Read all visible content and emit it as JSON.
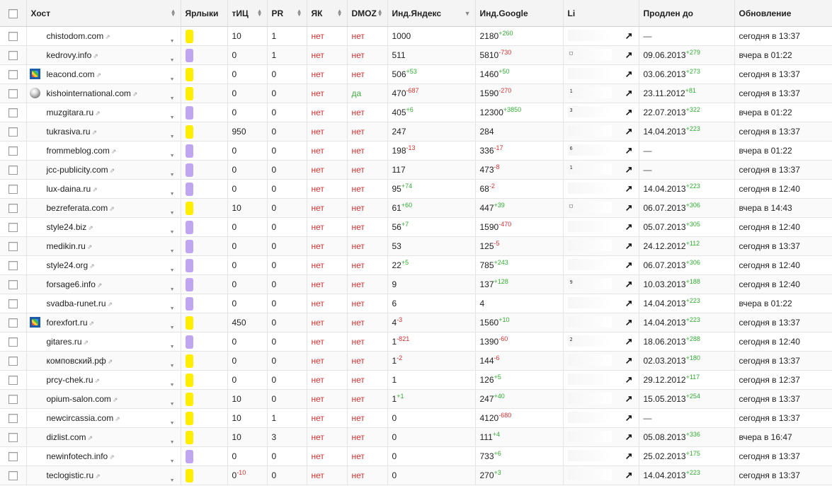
{
  "header": {
    "host": "Хост",
    "labels": "Ярлыки",
    "tic": "тИЦ",
    "pr": "PR",
    "yak": "ЯК",
    "dmoz": "DMOZ",
    "ind_yandex": "Инд.Яндекс",
    "ind_google": "Инд.Google",
    "li": "Li",
    "prolong": "Продлен до",
    "update": "Обновление"
  },
  "colors": {
    "yellow_label": "#ffee00",
    "purple_label": "#c0a6f0",
    "negative": "#cc3333",
    "positive": "#33aa33"
  },
  "rows": [
    {
      "host": "chistodom.com",
      "fav": "",
      "label": "yellow",
      "tic": "10",
      "tic_d": "",
      "pr": "1",
      "yak": "нет",
      "dmoz": "нет",
      "yandex": "1000",
      "yandex_d": "",
      "google": "2180",
      "google_d": "+260",
      "li": "",
      "prolong": "—",
      "prolong_d": "",
      "update": "сегодня в 13:37"
    },
    {
      "host": "kedrovy.info",
      "fav": "",
      "label": "purple",
      "tic": "0",
      "tic_d": "",
      "pr": "1",
      "yak": "нет",
      "dmoz": "нет",
      "yandex": "511",
      "yandex_d": "",
      "google": "5810",
      "google_d": "-730",
      "li": "□",
      "prolong": "09.06.2013",
      "prolong_d": "+279",
      "update": "вчера в 01:22"
    },
    {
      "host": "leacond.com",
      "fav": "joomla-icon",
      "label": "yellow",
      "tic": "0",
      "tic_d": "",
      "pr": "0",
      "yak": "нет",
      "dmoz": "нет",
      "yandex": "506",
      "yandex_d": "+53",
      "google": "1460",
      "google_d": "+50",
      "li": "",
      "prolong": "03.06.2013",
      "prolong_d": "+273",
      "update": "сегодня в 13:37"
    },
    {
      "host": "kishointernational.com",
      "fav": "globe-icon",
      "label": "yellow",
      "tic": "0",
      "tic_d": "",
      "pr": "0",
      "yak": "нет",
      "dmoz": "да",
      "yandex": "470",
      "yandex_d": "-687",
      "google": "1590",
      "google_d": "-270",
      "li": "1",
      "prolong": "23.11.2012",
      "prolong_d": "+81",
      "update": "сегодня в 13:37"
    },
    {
      "host": "muzgitara.ru",
      "fav": "",
      "label": "purple",
      "tic": "0",
      "tic_d": "",
      "pr": "0",
      "yak": "нет",
      "dmoz": "нет",
      "yandex": "405",
      "yandex_d": "+6",
      "google": "12300",
      "google_d": "+3850",
      "li": "3",
      "prolong": "22.07.2013",
      "prolong_d": "+322",
      "update": "вчера в 01:22"
    },
    {
      "host": "tukrasiva.ru",
      "fav": "",
      "label": "yellow",
      "tic": "950",
      "tic_d": "",
      "pr": "0",
      "yak": "нет",
      "dmoz": "нет",
      "yandex": "247",
      "yandex_d": "",
      "google": "284",
      "google_d": "",
      "li": "",
      "prolong": "14.04.2013",
      "prolong_d": "+223",
      "update": "сегодня в 13:37"
    },
    {
      "host": "frommeblog.com",
      "fav": "",
      "label": "purple",
      "tic": "0",
      "tic_d": "",
      "pr": "0",
      "yak": "нет",
      "dmoz": "нет",
      "yandex": "198",
      "yandex_d": "-13",
      "google": "336",
      "google_d": "-17",
      "li": "6",
      "prolong": "—",
      "prolong_d": "",
      "update": "вчера в 01:22"
    },
    {
      "host": "jcc-publicity.com",
      "fav": "",
      "label": "purple",
      "tic": "0",
      "tic_d": "",
      "pr": "0",
      "yak": "нет",
      "dmoz": "нет",
      "yandex": "117",
      "yandex_d": "",
      "google": "473",
      "google_d": "-8",
      "li": "1",
      "prolong": "—",
      "prolong_d": "",
      "update": "сегодня в 13:37"
    },
    {
      "host": "lux-daina.ru",
      "fav": "",
      "label": "purple",
      "tic": "0",
      "tic_d": "",
      "pr": "0",
      "yak": "нет",
      "dmoz": "нет",
      "yandex": "95",
      "yandex_d": "+74",
      "google": "68",
      "google_d": "-2",
      "li": "",
      "prolong": "14.04.2013",
      "prolong_d": "+223",
      "update": "сегодня в 12:40"
    },
    {
      "host": "bezreferata.com",
      "fav": "",
      "label": "yellow",
      "tic": "10",
      "tic_d": "",
      "pr": "0",
      "yak": "нет",
      "dmoz": "нет",
      "yandex": "61",
      "yandex_d": "+60",
      "google": "447",
      "google_d": "+39",
      "li": "□",
      "prolong": "06.07.2013",
      "prolong_d": "+306",
      "update": "вчера в 14:43"
    },
    {
      "host": "style24.biz",
      "fav": "",
      "label": "purple",
      "tic": "0",
      "tic_d": "",
      "pr": "0",
      "yak": "нет",
      "dmoz": "нет",
      "yandex": "56",
      "yandex_d": "+7",
      "google": "1590",
      "google_d": "-470",
      "li": "",
      "prolong": "05.07.2013",
      "prolong_d": "+305",
      "update": "сегодня в 12:40"
    },
    {
      "host": "medikin.ru",
      "fav": "",
      "label": "purple",
      "tic": "0",
      "tic_d": "",
      "pr": "0",
      "yak": "нет",
      "dmoz": "нет",
      "yandex": "53",
      "yandex_d": "",
      "google": "125",
      "google_d": "-5",
      "li": "",
      "prolong": "24.12.2012",
      "prolong_d": "+112",
      "update": "сегодня в 13:37"
    },
    {
      "host": "style24.org",
      "fav": "",
      "label": "purple",
      "tic": "0",
      "tic_d": "",
      "pr": "0",
      "yak": "нет",
      "dmoz": "нет",
      "yandex": "22",
      "yandex_d": "+5",
      "google": "785",
      "google_d": "+243",
      "li": "",
      "prolong": "06.07.2013",
      "prolong_d": "+306",
      "update": "сегодня в 12:40"
    },
    {
      "host": "forsage6.info",
      "fav": "",
      "label": "purple",
      "tic": "0",
      "tic_d": "",
      "pr": "0",
      "yak": "нет",
      "dmoz": "нет",
      "yandex": "9",
      "yandex_d": "",
      "google": "137",
      "google_d": "+128",
      "li": "9",
      "prolong": "10.03.2013",
      "prolong_d": "+188",
      "update": "сегодня в 12:40"
    },
    {
      "host": "svadba-runet.ru",
      "fav": "",
      "label": "purple",
      "tic": "0",
      "tic_d": "",
      "pr": "0",
      "yak": "нет",
      "dmoz": "нет",
      "yandex": "6",
      "yandex_d": "",
      "google": "4",
      "google_d": "",
      "li": "",
      "prolong": "14.04.2013",
      "prolong_d": "+223",
      "update": "вчера в 01:22"
    },
    {
      "host": "forexfort.ru",
      "fav": "joomla-icon",
      "label": "yellow",
      "tic": "450",
      "tic_d": "",
      "pr": "0",
      "yak": "нет",
      "dmoz": "нет",
      "yandex": "4",
      "yandex_d": "-3",
      "google": "1560",
      "google_d": "+10",
      "li": "",
      "prolong": "14.04.2013",
      "prolong_d": "+223",
      "update": "сегодня в 13:37"
    },
    {
      "host": "gitares.ru",
      "fav": "",
      "label": "purple",
      "tic": "0",
      "tic_d": "",
      "pr": "0",
      "yak": "нет",
      "dmoz": "нет",
      "yandex": "1",
      "yandex_d": "-821",
      "google": "1390",
      "google_d": "-60",
      "li": "2",
      "prolong": "18.06.2013",
      "prolong_d": "+288",
      "update": "сегодня в 12:40"
    },
    {
      "host": "комповский.рф",
      "fav": "",
      "label": "yellow",
      "tic": "0",
      "tic_d": "",
      "pr": "0",
      "yak": "нет",
      "dmoz": "нет",
      "yandex": "1",
      "yandex_d": "-2",
      "google": "144",
      "google_d": "-6",
      "li": "",
      "prolong": "02.03.2013",
      "prolong_d": "+180",
      "update": "сегодня в 13:37"
    },
    {
      "host": "prcy-chek.ru",
      "fav": "",
      "label": "yellow",
      "tic": "0",
      "tic_d": "",
      "pr": "0",
      "yak": "нет",
      "dmoz": "нет",
      "yandex": "1",
      "yandex_d": "",
      "google": "126",
      "google_d": "+5",
      "li": "",
      "prolong": "29.12.2012",
      "prolong_d": "+117",
      "update": "сегодня в 12:37"
    },
    {
      "host": "opium-salon.com",
      "fav": "",
      "label": "yellow",
      "tic": "10",
      "tic_d": "",
      "pr": "0",
      "yak": "нет",
      "dmoz": "нет",
      "yandex": "1",
      "yandex_d": "+1",
      "google": "247",
      "google_d": "+40",
      "li": "",
      "prolong": "15.05.2013",
      "prolong_d": "+254",
      "update": "сегодня в 13:37"
    },
    {
      "host": "newcircassia.com",
      "fav": "",
      "label": "yellow",
      "tic": "10",
      "tic_d": "",
      "pr": "1",
      "yak": "нет",
      "dmoz": "нет",
      "yandex": "0",
      "yandex_d": "",
      "google": "4120",
      "google_d": "-680",
      "li": "",
      "prolong": "—",
      "prolong_d": "",
      "update": "сегодня в 13:37"
    },
    {
      "host": "dizlist.com",
      "fav": "",
      "label": "yellow",
      "tic": "10",
      "tic_d": "",
      "pr": "3",
      "yak": "нет",
      "dmoz": "нет",
      "yandex": "0",
      "yandex_d": "",
      "google": "111",
      "google_d": "+4",
      "li": "",
      "prolong": "05.08.2013",
      "prolong_d": "+336",
      "update": "вчера в 16:47"
    },
    {
      "host": "newinfotech.info",
      "fav": "",
      "label": "purple",
      "tic": "0",
      "tic_d": "",
      "pr": "0",
      "yak": "нет",
      "dmoz": "нет",
      "yandex": "0",
      "yandex_d": "",
      "google": "733",
      "google_d": "+6",
      "li": "",
      "prolong": "25.02.2013",
      "prolong_d": "+175",
      "update": "сегодня в 13:37"
    },
    {
      "host": "teclogistic.ru",
      "fav": "",
      "label": "yellow",
      "tic": "0",
      "tic_d": "-10",
      "pr": "0",
      "yak": "нет",
      "dmoz": "нет",
      "yandex": "0",
      "yandex_d": "",
      "google": "270",
      "google_d": "+3",
      "li": "",
      "prolong": "14.04.2013",
      "prolong_d": "+223",
      "update": "сегодня в 13:37"
    }
  ]
}
